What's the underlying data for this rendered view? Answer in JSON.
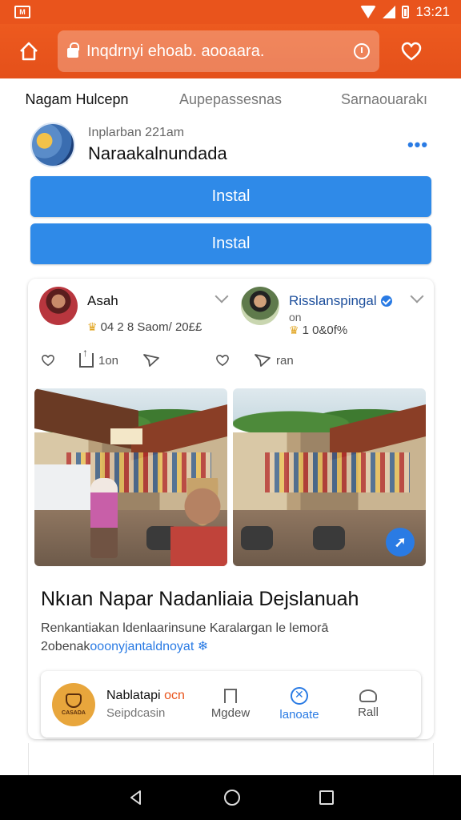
{
  "status_bar": {
    "time": "13:21"
  },
  "address_bar": {
    "url": "Inqdrnyi ehoab. aooaara."
  },
  "tabs": [
    {
      "label": "Nagam Hulcepn",
      "active": true
    },
    {
      "label": "Aupepassesnas",
      "active": false
    },
    {
      "label": "Sarnaouarakı",
      "active": false
    }
  ],
  "profile": {
    "subtitle": "Inplarban 221am",
    "name": "Naraakalnundada"
  },
  "install_buttons": [
    "Instal",
    "Instal"
  ],
  "post": {
    "author_left": {
      "name": "Asah",
      "stats": "04 2 8 Saom/ 20££"
    },
    "author_right": {
      "name": "Risslanspingal",
      "meta": "on",
      "stats": "1 0&0f%"
    },
    "actions_left": {
      "share_count": "1on"
    },
    "actions_right": {
      "send_count": "ran"
    },
    "headline": "Nkıan Napar Nadanliaia Dejslanuah",
    "description_line1": "Renkantiakan ldenlaarinsune Karalargan le lemorā",
    "description_line2_prefix": "2obenak",
    "description_line2_link": "ooonyjantaldnoyat ❄"
  },
  "app_strip": {
    "logo_text": "CASADA",
    "title": "Nablatapi",
    "title_accent": "ocn",
    "subtitle": "Seipdcasin",
    "buttons": [
      {
        "label": "Mgdew",
        "icon": "bookmark-icon"
      },
      {
        "label": "lanoate",
        "icon": "globe-icon"
      },
      {
        "label": "Rall",
        "icon": "people-icon"
      }
    ]
  },
  "colors": {
    "accent": "#e9541c",
    "primary": "#2f8ae8"
  }
}
